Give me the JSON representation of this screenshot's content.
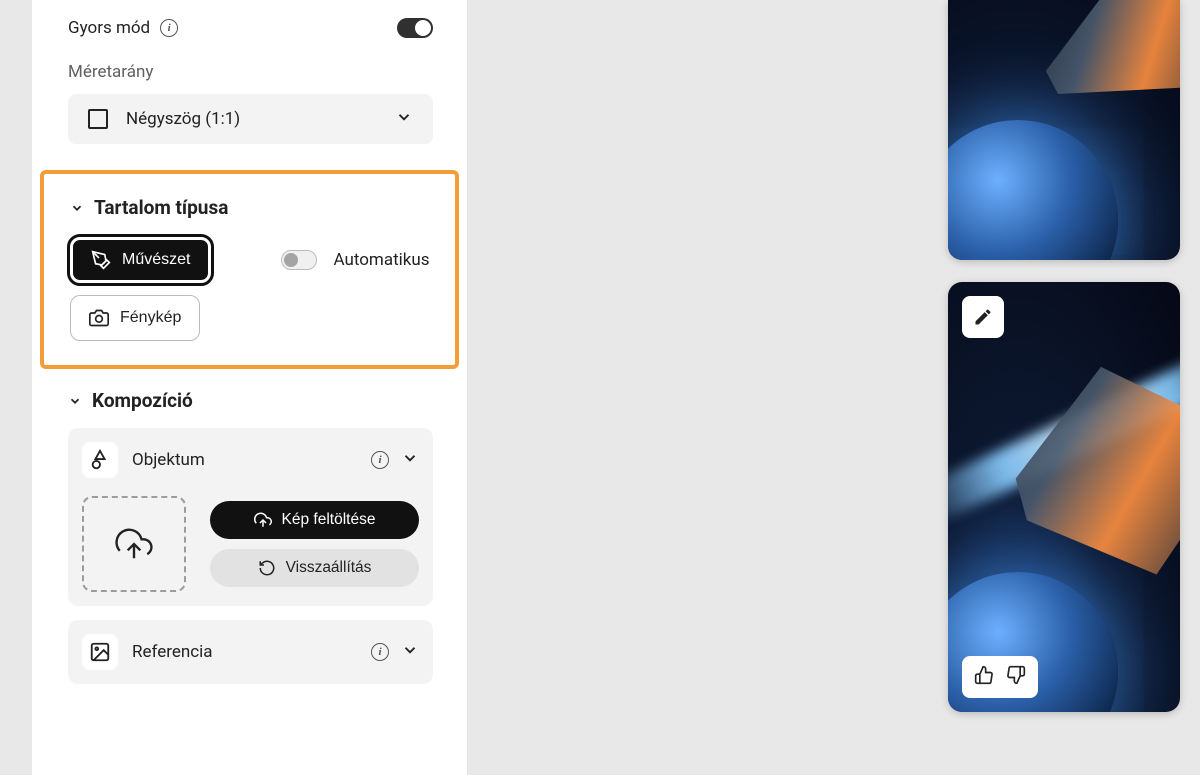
{
  "quick_mode": {
    "label": "Gyors mód",
    "on": true
  },
  "aspect": {
    "section_label": "Méretarány",
    "selected": "Négyszög (1:1)"
  },
  "content_type": {
    "title": "Tartalom típusa",
    "art_label": "Művészet",
    "photo_label": "Fénykép",
    "auto_label": "Automatikus",
    "auto_on": false
  },
  "composition": {
    "title": "Kompozíció",
    "object": {
      "title": "Objektum",
      "upload_label": "Kép feltöltése",
      "reset_label": "Visszaállítás"
    },
    "reference": {
      "title": "Referencia"
    }
  }
}
